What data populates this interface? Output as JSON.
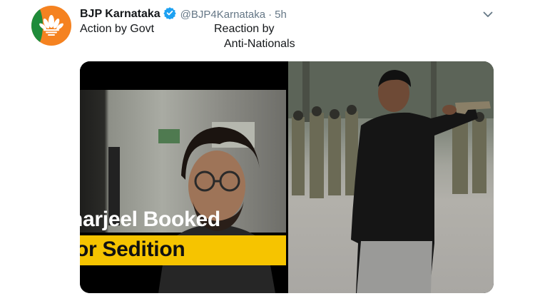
{
  "tweet": {
    "display_name": "BJP Karnataka",
    "handle": "@BJP4Karnataka",
    "separator": "·",
    "time": "5h",
    "text_line1_left": "Action by Govt",
    "text_line1_right": "Reaction by",
    "text_line2_right": "Anti-Nationals"
  },
  "media": {
    "left_caption_line1": "harjeel Booked",
    "left_caption_line2": "or Sedition"
  },
  "colors": {
    "avatar_orange": "#f58220",
    "avatar_green": "#1f8b3a",
    "verified_blue": "#1da1f2",
    "caption_yellow": "#f6c400",
    "secondary_text": "#657786"
  },
  "icons": {
    "verified": "verified-badge-icon",
    "chevron": "chevron-down-icon",
    "avatar_logo": "lotus-logo-icon"
  }
}
